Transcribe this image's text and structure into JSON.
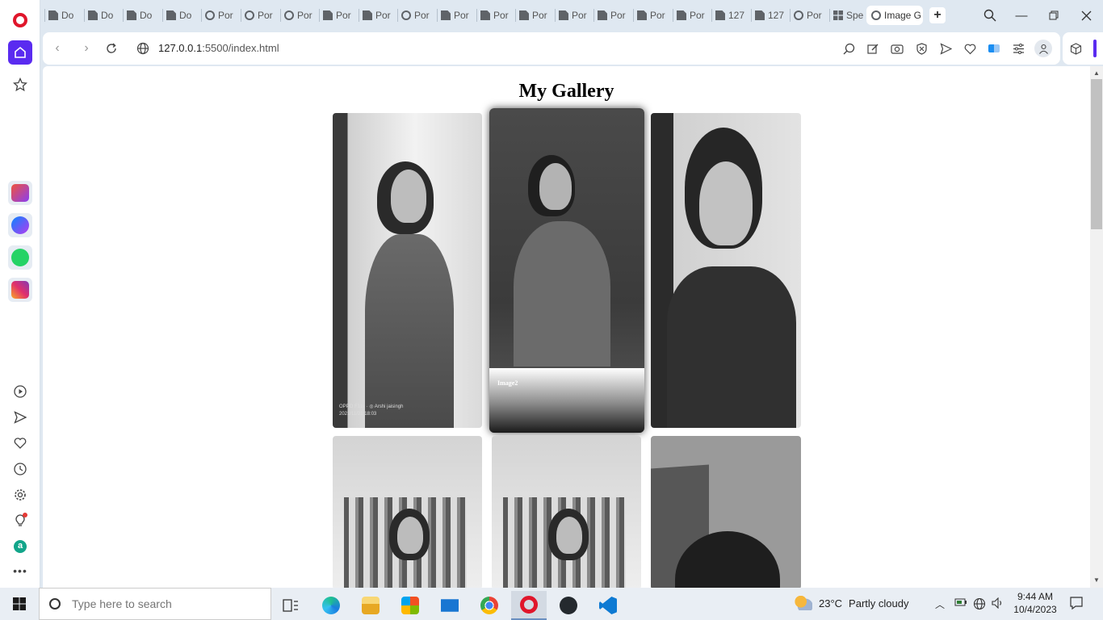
{
  "browser": {
    "tabs": [
      {
        "label": "Do",
        "icon": "document-icon"
      },
      {
        "label": "Do",
        "icon": "document-icon"
      },
      {
        "label": "Do",
        "icon": "document-icon"
      },
      {
        "label": "Do",
        "icon": "document-icon"
      },
      {
        "label": "Por",
        "icon": "globe-icon"
      },
      {
        "label": "Por",
        "icon": "globe-icon"
      },
      {
        "label": "Por",
        "icon": "globe-icon"
      },
      {
        "label": "Por",
        "icon": "document-icon"
      },
      {
        "label": "Por",
        "icon": "document-icon"
      },
      {
        "label": "Por",
        "icon": "globe-icon"
      },
      {
        "label": "Por",
        "icon": "document-icon"
      },
      {
        "label": "Por",
        "icon": "document-icon"
      },
      {
        "label": "Por",
        "icon": "document-icon"
      },
      {
        "label": "Por",
        "icon": "document-icon"
      },
      {
        "label": "Por",
        "icon": "document-icon"
      },
      {
        "label": "Por",
        "icon": "document-icon"
      },
      {
        "label": "Por",
        "icon": "document-icon"
      },
      {
        "label": "127",
        "icon": "document-icon"
      },
      {
        "label": "127",
        "icon": "document-icon"
      },
      {
        "label": "Por",
        "icon": "globe-icon"
      },
      {
        "label": "Spe",
        "icon": "grid-icon"
      }
    ],
    "active_tab": {
      "label": "Image G",
      "icon": "globe-icon"
    },
    "url": {
      "host": "127.0.0.1",
      "path": ":5500/index.html"
    }
  },
  "page": {
    "title": "My Gallery",
    "hover_caption": "Image2",
    "photo_stamp": {
      "line1": "OPPO F11s · ◎ Arshi jaisingh",
      "line2": "2021/11/21 18:03"
    }
  },
  "taskbar": {
    "search_placeholder": "Type here to search",
    "weather": {
      "temp": "23°C",
      "condition": "Partly cloudy"
    },
    "time": "9:44 AM",
    "date": "10/4/2023"
  },
  "colors": {
    "opera_red": "#e0162b",
    "home_active": "#5a2bf0",
    "taskbar_bg": "#e9eef4"
  }
}
